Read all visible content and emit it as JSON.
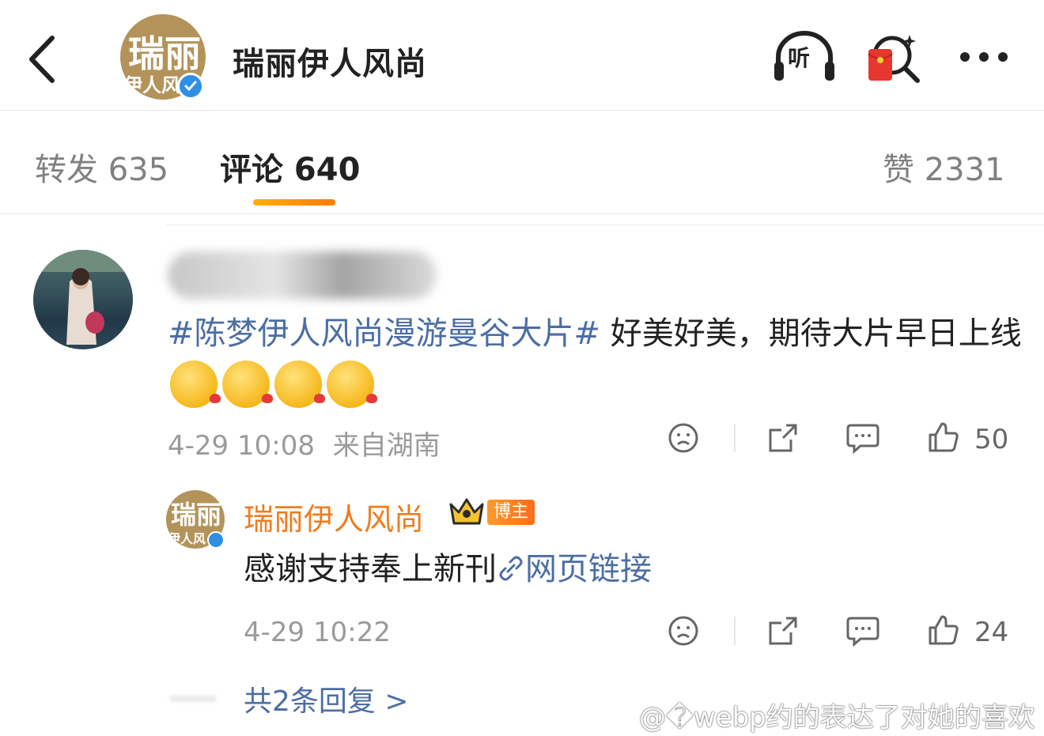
{
  "header": {
    "title": "瑞丽伊人风尚",
    "avatar_logo_top": "瑞丽",
    "avatar_logo_bottom": "伊人风",
    "listen_label": "听"
  },
  "tabs": {
    "repost": "转发 635",
    "comment": "评论 640",
    "like": "赞 2331"
  },
  "comment": {
    "hashtag": "#陈梦伊人风尚漫游曼谷大片#",
    "text": " 好美好美，期待大片早日上线",
    "emoji_count": 4,
    "time": "4-29 10:08",
    "location": "来自湖南",
    "likes": "50"
  },
  "reply": {
    "author": "瑞丽伊人风尚",
    "badge": "博主",
    "text": "感谢支持奉上新刊",
    "link_text": "网页链接",
    "time": "4-29 10:22",
    "likes": "24"
  },
  "more_replies": "共2条回复 >",
  "watermark": "@�webp约的表达了对她的喜欢",
  "colors": {
    "accent": "#ff8a00",
    "link": "#4c6ea3",
    "author_orange": "#f07c1d",
    "verified_blue": "#2f8fe5"
  }
}
